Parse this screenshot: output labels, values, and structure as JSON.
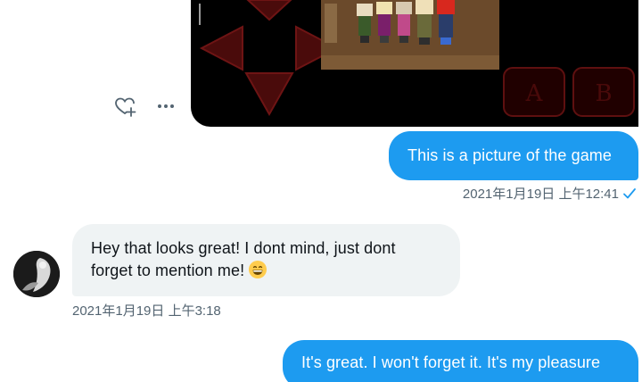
{
  "messages": [
    {
      "id": "m1",
      "direction": "sent",
      "text": "This is a picture of the game",
      "timestamp": "2021年1月19日 上午12:41",
      "status": "read"
    },
    {
      "id": "m2",
      "direction": "received",
      "text": "Hey that looks great! I dont mind, just dont forget to mention me!",
      "emoji": "grinning-face",
      "timestamp": "2021年1月19日 上午3:18"
    },
    {
      "id": "m3",
      "direction": "sent",
      "text": "It's great. I won't forget it. It's my pleasure"
    }
  ],
  "media": {
    "type": "game-screenshot",
    "buttons": {
      "a": "A",
      "b": "B"
    }
  },
  "actions": {
    "react": "add-reaction-icon",
    "more": "more-icon"
  },
  "colors": {
    "sent_bubble": "#1d9bf0",
    "received_bubble": "#eff3f4",
    "timestamp": "#536471",
    "read_check": "#1d9bf0",
    "dpad": "#4a0a0a"
  }
}
